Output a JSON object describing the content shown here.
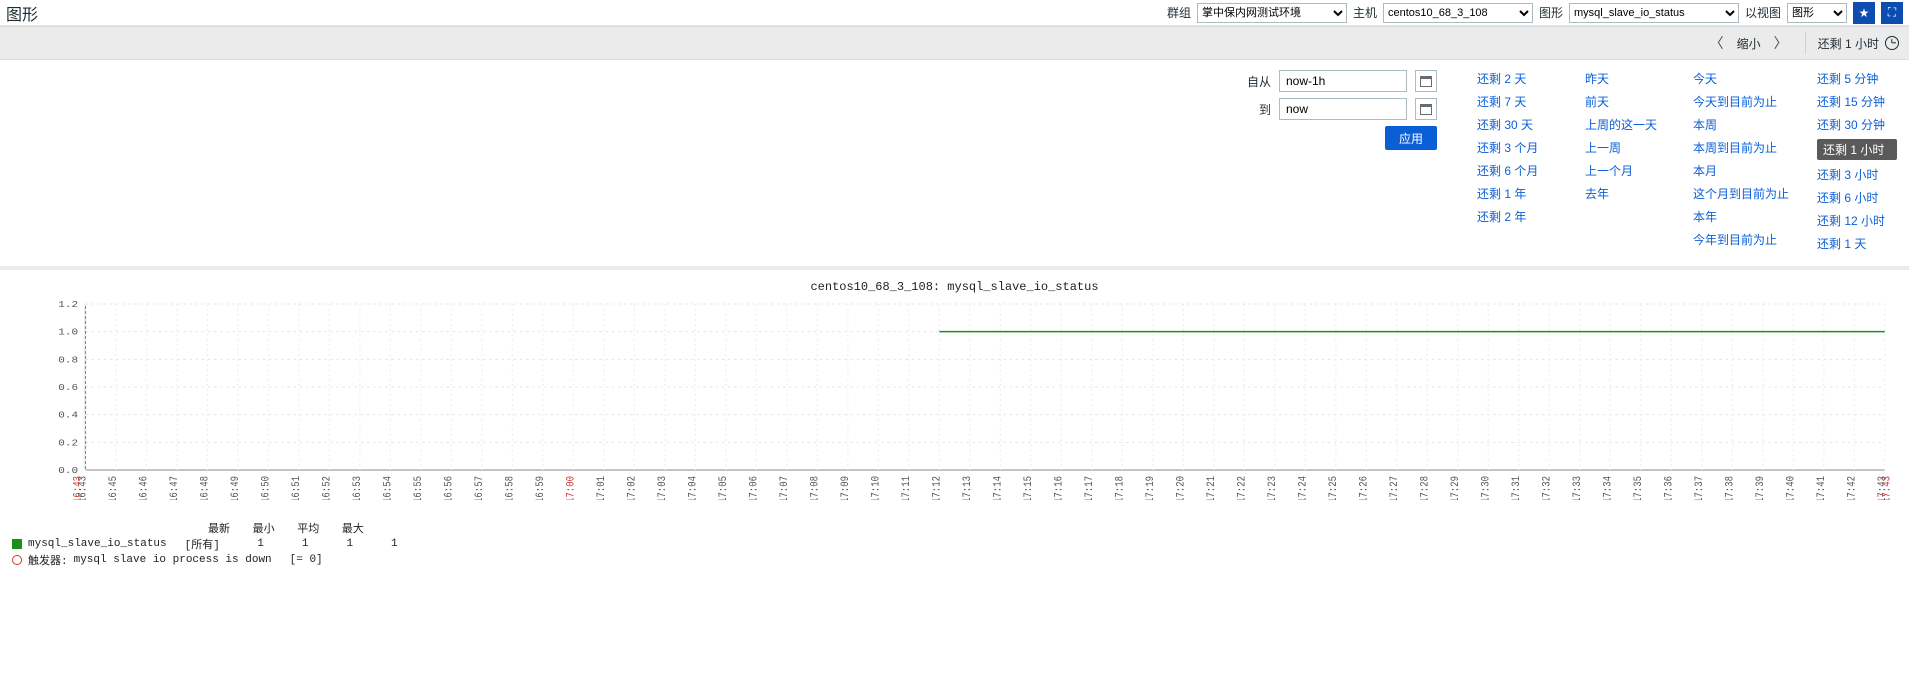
{
  "header": {
    "page_title": "图形",
    "group_label": "群组",
    "group_value": "掌中保内网测试环境",
    "host_label": "主机",
    "host_value": "centos10_68_3_108",
    "graph_label": "图形",
    "graph_value": "mysql_slave_io_status",
    "view_label": "以视图",
    "view_value": "图形"
  },
  "nav_strip": {
    "zoom_out": "缩小",
    "current_range": "还剩 1 小时"
  },
  "range_inputs": {
    "from_label": "自从",
    "from_value": "now-1h",
    "to_label": "到",
    "to_value": "now",
    "apply": "应用"
  },
  "presets": {
    "col1": [
      "还剩 2 天",
      "还剩 7 天",
      "还剩 30 天",
      "还剩 3 个月",
      "还剩 6 个月",
      "还剩 1 年",
      "还剩 2 年"
    ],
    "col2": [
      "昨天",
      "前天",
      "上周的这一天",
      "上一周",
      "上一个月",
      "去年"
    ],
    "col3": [
      "今天",
      "今天到目前为止",
      "本周",
      "本周到目前为止",
      "本月",
      "这个月到目前为止",
      "本年",
      "今年到目前为止"
    ],
    "col4": [
      "还剩 5 分钟",
      "还剩 15 分钟",
      "还剩 30 分钟",
      "还剩 1 小时",
      "还剩 3 小时",
      "还剩 6 小时",
      "还剩 12 小时",
      "还剩 1 天"
    ],
    "selected": "还剩 1 小时"
  },
  "chart_data": {
    "type": "line",
    "title": "centos10_68_3_108: mysql_slave_io_status",
    "ylabel": "",
    "ylim": [
      0,
      1.2
    ],
    "y_ticks": [
      0,
      0.2,
      0.4,
      0.6,
      0.8,
      1.0,
      1.2
    ],
    "x_start_label": "12-02 16:43",
    "x_end_label": "12-02 17:43",
    "x_ticks": [
      "16:43",
      "16:45",
      "16:46",
      "16:47",
      "16:48",
      "16:49",
      "16:50",
      "16:51",
      "16:52",
      "16:53",
      "16:54",
      "16:55",
      "16:56",
      "16:57",
      "16:58",
      "16:59",
      "17:00",
      "17:01",
      "17:02",
      "17:03",
      "17:04",
      "17:05",
      "17:06",
      "17:07",
      "17:08",
      "17:09",
      "17:10",
      "17:11",
      "17:12",
      "17:13",
      "17:14",
      "17:15",
      "17:16",
      "17:17",
      "17:18",
      "17:19",
      "17:20",
      "17:21",
      "17:22",
      "17:23",
      "17:24",
      "17:25",
      "17:26",
      "17:27",
      "17:28",
      "17:29",
      "17:30",
      "17:31",
      "17:32",
      "17:33",
      "17:34",
      "17:35",
      "17:36",
      "17:37",
      "17:38",
      "17:39",
      "17:40",
      "17:41",
      "17:42",
      "17:43"
    ],
    "x_hour_mark": "17:00",
    "series": [
      {
        "name": "mysql_slave_io_status",
        "color": "#1a8f1a",
        "x": [
          "17:12",
          "17:43"
        ],
        "y": [
          1,
          1
        ],
        "note": "no data before 17:12; constant 1 after"
      }
    ],
    "legend_headers": [
      "最新",
      "最小",
      "平均",
      "最大"
    ],
    "legend_rows": [
      {
        "swatch": "#1a8f1a",
        "name": "mysql_slave_io_status",
        "extra": "[所有]",
        "values": [
          "1",
          "1",
          "1",
          "1"
        ]
      }
    ],
    "trigger_row": {
      "label": "触发器:",
      "text": "mysql slave io process is down",
      "cond": "[= 0]"
    }
  }
}
